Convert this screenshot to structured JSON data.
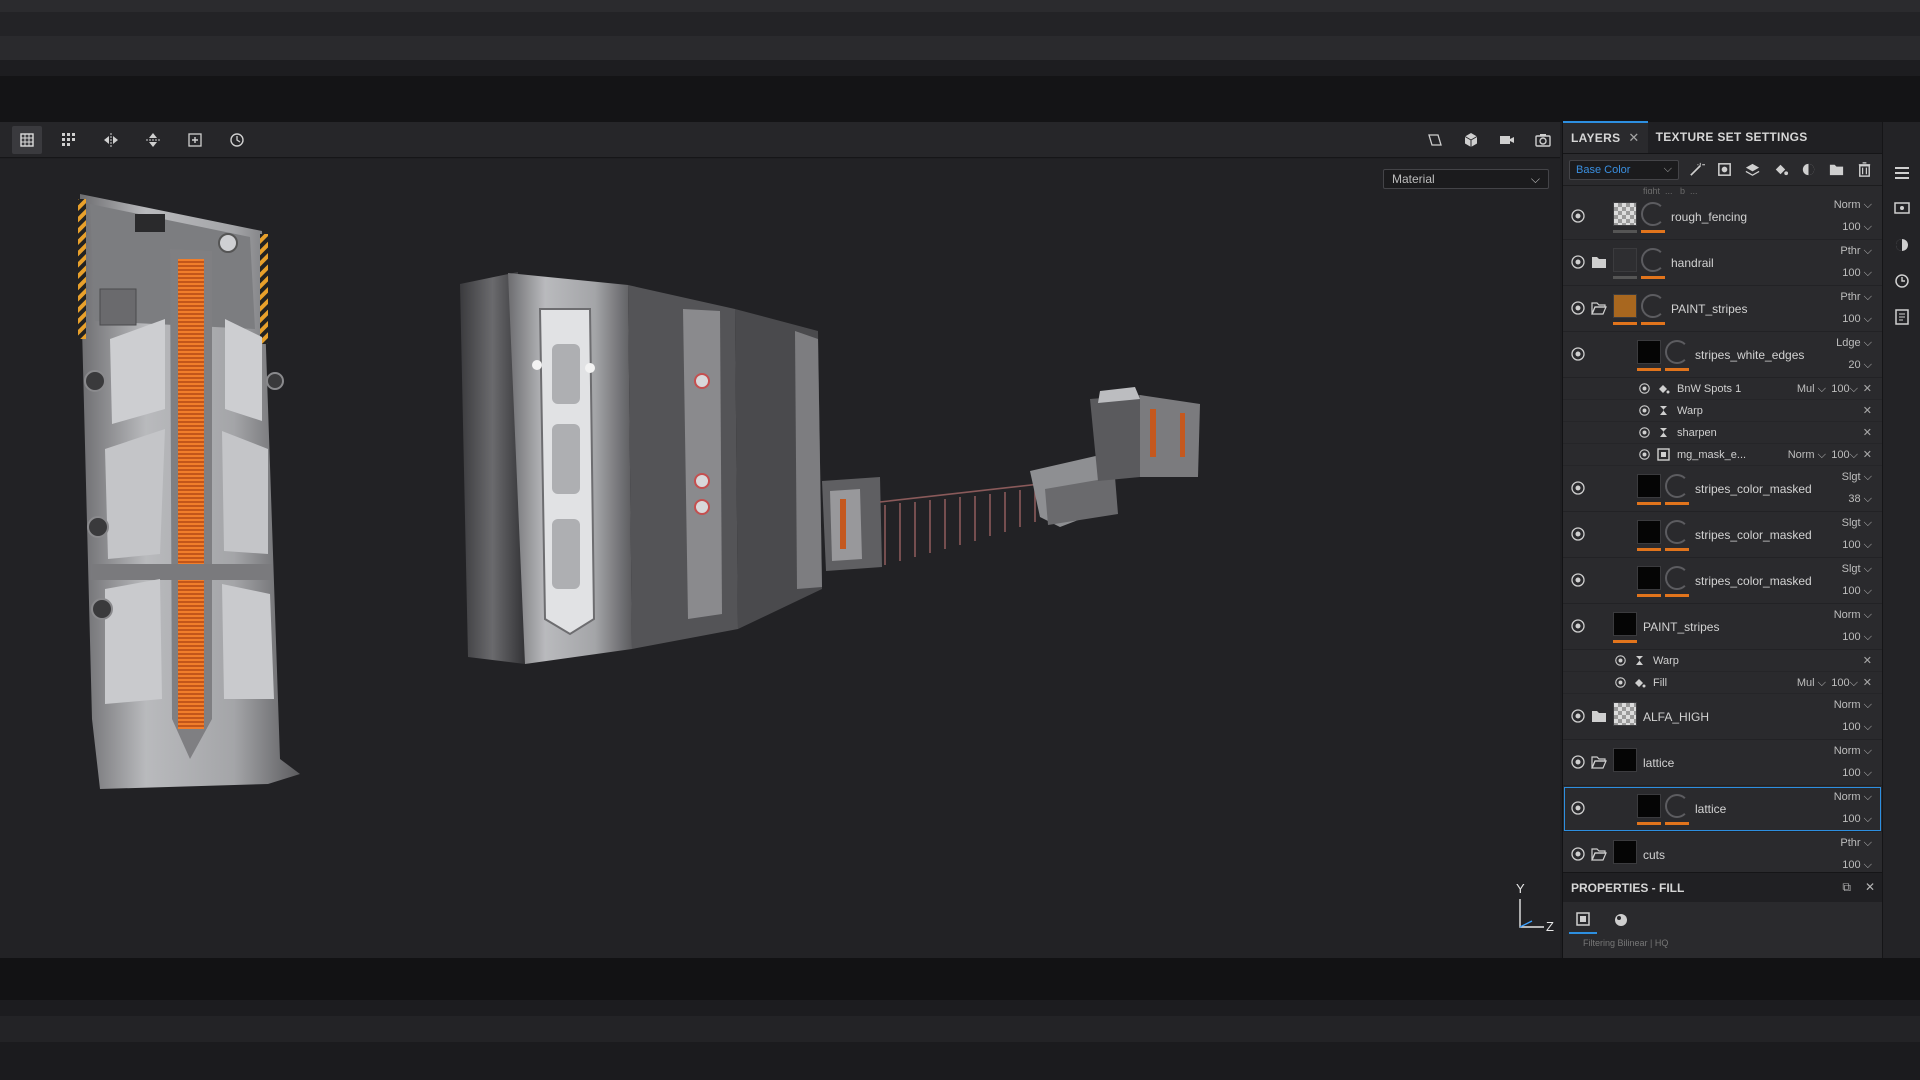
{
  "viewport": {
    "shading_mode": "Material",
    "axis": {
      "y": "Y",
      "z": "Z"
    }
  },
  "toolbar": {
    "left_icons": [
      "grid-select-icon",
      "multi-grid-icon",
      "mirror-x-icon",
      "mirror-y-icon",
      "add-icon",
      "reset-icon"
    ],
    "right_icons": [
      "2d-view-icon",
      "3d-view-icon",
      "camera-icon",
      "screenshot-icon"
    ]
  },
  "panel": {
    "tabs": [
      {
        "label": "LAYERS",
        "closable": true,
        "active": true
      },
      {
        "label": "TEXTURE SET SETTINGS",
        "closable": false,
        "active": false
      }
    ],
    "channel": "Base Color",
    "top_stub": "fight_... _b_..."
  },
  "layers": [
    {
      "name": "rough_fencing",
      "blend": "Norm",
      "opacity": "100",
      "thumb": "checker",
      "folder": false,
      "indent": 0,
      "mask": true,
      "under": "gray"
    },
    {
      "name": "handrail",
      "blend": "Pthr",
      "opacity": "100",
      "thumb": "dark",
      "folder": "closed",
      "indent": 0,
      "mask": true,
      "under": "gray"
    },
    {
      "name": "PAINT_stripes",
      "blend": "Pthr",
      "opacity": "100",
      "thumb": "orange",
      "folder": "open",
      "indent": 0,
      "mask": true,
      "under": "orange"
    },
    {
      "name": "stripes_white_edges",
      "blend": "Ldge",
      "opacity": "20",
      "thumb": "black",
      "folder": false,
      "indent": 1,
      "mask": true,
      "under": "orange",
      "effects": [
        {
          "name": "BnW Spots 1",
          "icon": "fill-icon",
          "blend": "Mul",
          "opacity": "100"
        },
        {
          "name": "Warp",
          "icon": "filter-icon",
          "blend": "",
          "opacity": ""
        },
        {
          "name": "sharpen",
          "icon": "filter-icon",
          "blend": "",
          "opacity": ""
        },
        {
          "name": "mg_mask_e...",
          "icon": "mask-generator-icon",
          "blend": "Norm",
          "opacity": "100"
        }
      ]
    },
    {
      "name": "stripes_color_masked",
      "blend": "Slgt",
      "opacity": "38",
      "thumb": "black",
      "folder": false,
      "indent": 1,
      "mask": true,
      "under": "orange"
    },
    {
      "name": "stripes_color_masked",
      "blend": "Slgt",
      "opacity": "100",
      "thumb": "black",
      "folder": false,
      "indent": 1,
      "mask": true,
      "under": "orange"
    },
    {
      "name": "stripes_color_masked",
      "blend": "Slgt",
      "opacity": "100",
      "thumb": "black",
      "folder": false,
      "indent": 1,
      "mask": true,
      "under": "orange"
    },
    {
      "name": "PAINT_stripes",
      "blend": "Norm",
      "opacity": "100",
      "thumb": "black",
      "folder": false,
      "indent": 0,
      "mask": false,
      "under": "orange",
      "effects": [
        {
          "name": "Warp",
          "icon": "filter-icon",
          "blend": "",
          "opacity": ""
        },
        {
          "name": "Fill",
          "icon": "fill-icon",
          "blend": "Mul",
          "opacity": "100"
        }
      ]
    },
    {
      "name": "ALFA_HIGH",
      "blend": "Norm",
      "opacity": "100",
      "thumb": "checker",
      "folder": "closed",
      "indent": 0,
      "mask": false,
      "under": "none"
    },
    {
      "name": "lattice",
      "blend": "Norm",
      "opacity": "100",
      "thumb": "black",
      "folder": "open",
      "indent": 0,
      "mask": false,
      "under": "none"
    },
    {
      "name": "lattice",
      "blend": "Norm",
      "opacity": "100",
      "thumb": "black",
      "folder": false,
      "indent": 1,
      "mask": true,
      "under": "orange",
      "selected": true
    },
    {
      "name": "cuts",
      "blend": "Pthr",
      "opacity": "100",
      "thumb": "black",
      "folder": "open",
      "indent": 0,
      "mask": false,
      "under": "none"
    }
  ],
  "properties": {
    "title": "PROPERTIES - FILL",
    "row_stub": "Filtering   Bilinear | HQ"
  },
  "colors": {
    "accent": "#2d8fe0",
    "orange": "#e1741c",
    "panel_bg": "#2a2a2d",
    "viewport_bg": "#222225"
  }
}
